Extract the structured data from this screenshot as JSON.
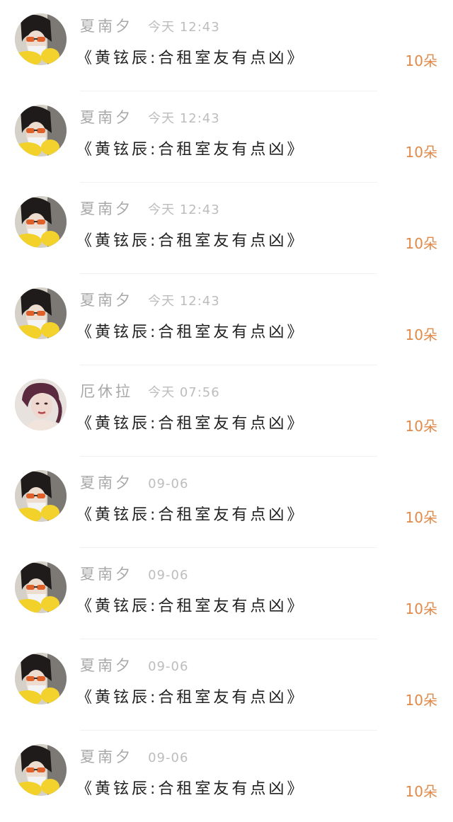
{
  "colors": {
    "background": "#ffffff",
    "name_text": "#a8a8a8",
    "time_text": "#bdbdbd",
    "message_text": "#222222",
    "count_accent": "#e08a4a",
    "divider": "#f1f1f1"
  },
  "comments": [
    {
      "avatar": "woman-sunglasses-lemons-avatar",
      "name": "夏南夕",
      "time": "今天 12:43",
      "message": "《黄铉辰:合租室友有点凶》",
      "count": "10朵"
    },
    {
      "avatar": "woman-sunglasses-lemons-avatar",
      "name": "夏南夕",
      "time": "今天 12:43",
      "message": "《黄铉辰:合租室友有点凶》",
      "count": "10朵"
    },
    {
      "avatar": "woman-sunglasses-lemons-avatar",
      "name": "夏南夕",
      "time": "今天 12:43",
      "message": "《黄铉辰:合租室友有点凶》",
      "count": "10朵"
    },
    {
      "avatar": "woman-sunglasses-lemons-avatar",
      "name": "夏南夕",
      "time": "今天 12:43",
      "message": "《黄铉辰:合租室友有点凶》",
      "count": "10朵"
    },
    {
      "avatar": "woman-portrait-avatar",
      "name": "厄休拉",
      "time": "今天 07:56",
      "message": "《黄铉辰:合租室友有点凶》",
      "count": "10朵"
    },
    {
      "avatar": "woman-sunglasses-lemons-avatar",
      "name": "夏南夕",
      "time": "09-06",
      "message": "《黄铉辰:合租室友有点凶》",
      "count": "10朵"
    },
    {
      "avatar": "woman-sunglasses-lemons-avatar",
      "name": "夏南夕",
      "time": "09-06",
      "message": "《黄铉辰:合租室友有点凶》",
      "count": "10朵"
    },
    {
      "avatar": "woman-sunglasses-lemons-avatar",
      "name": "夏南夕",
      "time": "09-06",
      "message": "《黄铉辰:合租室友有点凶》",
      "count": "10朵"
    },
    {
      "avatar": "woman-sunglasses-lemons-avatar",
      "name": "夏南夕",
      "time": "09-06",
      "message": "《黄铉辰:合租室友有点凶》",
      "count": "10朵"
    }
  ]
}
